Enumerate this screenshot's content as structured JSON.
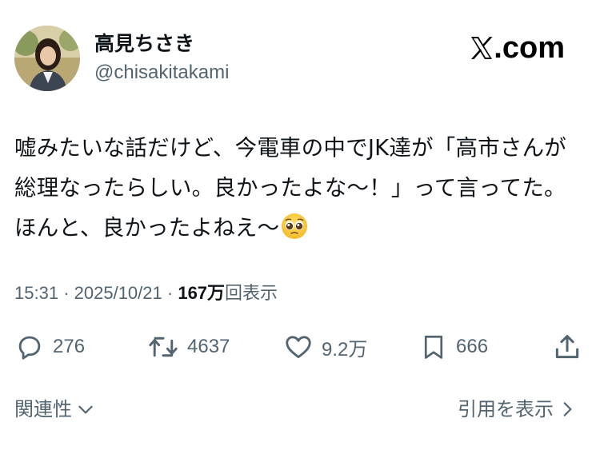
{
  "author": {
    "display_name": "高見ちさき",
    "handle": "@chisakitakami"
  },
  "brand": {
    "domain": ".com"
  },
  "tweet": {
    "text": "嘘みたいな話だけど、今電車の中でJK達が「高市さんが総理なったらしい。良かったよな〜！」って言ってた。ほんと、良かったよねえ〜",
    "emoji": "pleading-face"
  },
  "meta": {
    "time": "15:31",
    "separator": "·",
    "date": "2025/10/21",
    "views_count": "167万",
    "views_label": "回表示"
  },
  "actions": {
    "replies": "276",
    "retweets": "4637",
    "likes": "9.2万",
    "bookmarks": "666"
  },
  "footer": {
    "related_label": "関連性",
    "quotes_label": "引用を表示"
  },
  "colors": {
    "text": "#0f1419",
    "secondary": "#536471"
  }
}
